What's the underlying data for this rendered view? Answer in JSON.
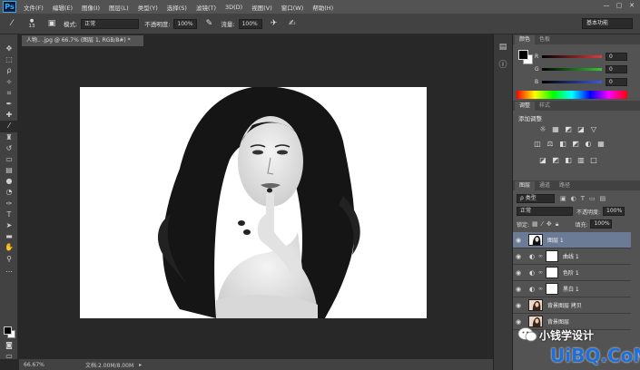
{
  "menubar": {
    "logo": "Ps",
    "items": [
      "文件(F)",
      "编辑(E)",
      "图像(I)",
      "图层(L)",
      "类型(Y)",
      "选择(S)",
      "滤镜(T)",
      "3D(D)",
      "视图(V)",
      "窗口(W)",
      "帮助(H)"
    ],
    "window_buttons": [
      "—",
      "▢",
      "✕"
    ]
  },
  "options": {
    "brush_size": "13",
    "mode_label": "模式:",
    "mode_value": "正常",
    "opacity_label": "不透明度:",
    "opacity_value": "100%",
    "flow_label": "流量:",
    "flow_value": "100%",
    "workspace": "基本功能"
  },
  "document": {
    "tab_title": "人物.. .jpg @ 66.7% (图层 1, RGB/8#) *",
    "zoom": "66.67%",
    "doc_size": "文档:2.00M/8.00M"
  },
  "color_panel": {
    "tabs": [
      "颜色",
      "色板"
    ],
    "sliders": [
      {
        "letter": "R",
        "value": "0",
        "color": "#e23a3a"
      },
      {
        "letter": "G",
        "value": "0",
        "color": "#3ac23a"
      },
      {
        "letter": "B",
        "value": "0",
        "color": "#3a5ae2"
      }
    ]
  },
  "adjustments_panel": {
    "tabs": [
      "调整",
      "样式"
    ],
    "title": "添加调整",
    "row1": [
      "☼",
      "▦",
      "◩",
      "◪",
      "▽"
    ],
    "row2": [
      "◫",
      "⚖",
      "◧",
      "◩",
      "◐",
      "▦"
    ],
    "row3": [
      "◪",
      "◩",
      "◧",
      "▥",
      "□"
    ]
  },
  "layers_panel": {
    "tabs": [
      "图层",
      "通道",
      "路径"
    ],
    "filter_value": "ρ 类型",
    "blend_mode": "正常",
    "opacity_label": "不透明度:",
    "opacity_value": "100%",
    "lock_label": "锁定:",
    "fill_label": "填充:",
    "fill_value": "100%",
    "layers": [
      {
        "name": "图层 1",
        "type": "image",
        "selected": true
      },
      {
        "name": "曲线 1",
        "type": "adjustment",
        "selected": false
      },
      {
        "name": "色阶 1",
        "type": "adjustment",
        "selected": false
      },
      {
        "name": "黑白 1",
        "type": "adjustment",
        "selected": false
      },
      {
        "name": "背景图层 拷贝",
        "type": "photo",
        "selected": false
      },
      {
        "name": "背景图层",
        "type": "photo",
        "selected": false
      }
    ]
  },
  "watermark": {
    "text": "小钱学设计",
    "brand": "UiBQ.CoM"
  }
}
